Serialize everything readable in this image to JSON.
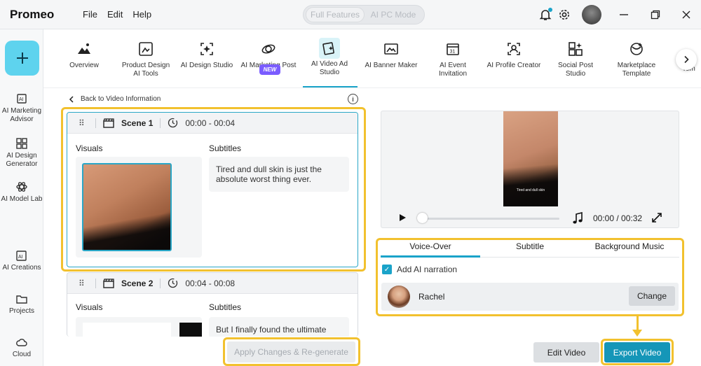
{
  "app": {
    "name": "Promeo"
  },
  "menu": [
    "File",
    "Edit",
    "Help"
  ],
  "mode_toggle": {
    "options": [
      "Full Features",
      "AI PC Mode"
    ],
    "selected": "Full Features"
  },
  "sidebar": {
    "items": [
      {
        "label": "AI Marketing Advisor",
        "icon": "ai-advisor-icon"
      },
      {
        "label": "AI Design Generator",
        "icon": "grid-icon"
      },
      {
        "label": "AI Model Lab",
        "icon": "atom-icon"
      },
      {
        "label": "AI Creations",
        "icon": "ai-creations-icon"
      },
      {
        "label": "Projects",
        "icon": "folder-icon"
      },
      {
        "label": "Cloud",
        "icon": "cloud-icon"
      }
    ]
  },
  "tools": [
    {
      "label": "Overview"
    },
    {
      "label": "Product Design AI Tools"
    },
    {
      "label": "AI Design Studio",
      "badge": "NEW"
    },
    {
      "label": "AI Marketing Post"
    },
    {
      "label": "AI Video Ad Studio",
      "active": true
    },
    {
      "label": "AI Banner Maker"
    },
    {
      "label": "AI Event Invitation"
    },
    {
      "label": "AI Profile Creator"
    },
    {
      "label": "Social Post Studio"
    },
    {
      "label": "Marketplace Template"
    }
  ],
  "tools_overflow_label": "Tem",
  "back_link": "Back to Video Information",
  "scenes": [
    {
      "title": "Scene 1",
      "time": "00:00 - 00:04",
      "visuals_label": "Visuals",
      "subtitles_label": "Subtitles",
      "subtitle": "Tired and dull skin is just the absolute worst thing ever."
    },
    {
      "title": "Scene 2",
      "time": "00:04 - 00:08",
      "visuals_label": "Visuals",
      "subtitles_label": "Subtitles",
      "subtitle": "But I finally found the ultimate"
    }
  ],
  "apply_button": "Apply Changes & Re-generate",
  "preview": {
    "video_subtitle": "Tired and dull skin",
    "time": "00:00 / 00:32",
    "progress": 0
  },
  "audio_tabs": [
    "Voice-Over",
    "Subtitle",
    "Background Music"
  ],
  "audio_tab_selected": "Voice-Over",
  "narration": {
    "label": "Add AI narration",
    "checked": true
  },
  "voice": {
    "name": "Rachel",
    "change_label": "Change"
  },
  "edit_button": "Edit Video",
  "export_button": "Export Video",
  "colors": {
    "accent": "#1aa3c9",
    "highlight": "#f2c12e",
    "plus_button": "#5ed3ee",
    "export": "#1596b8"
  }
}
